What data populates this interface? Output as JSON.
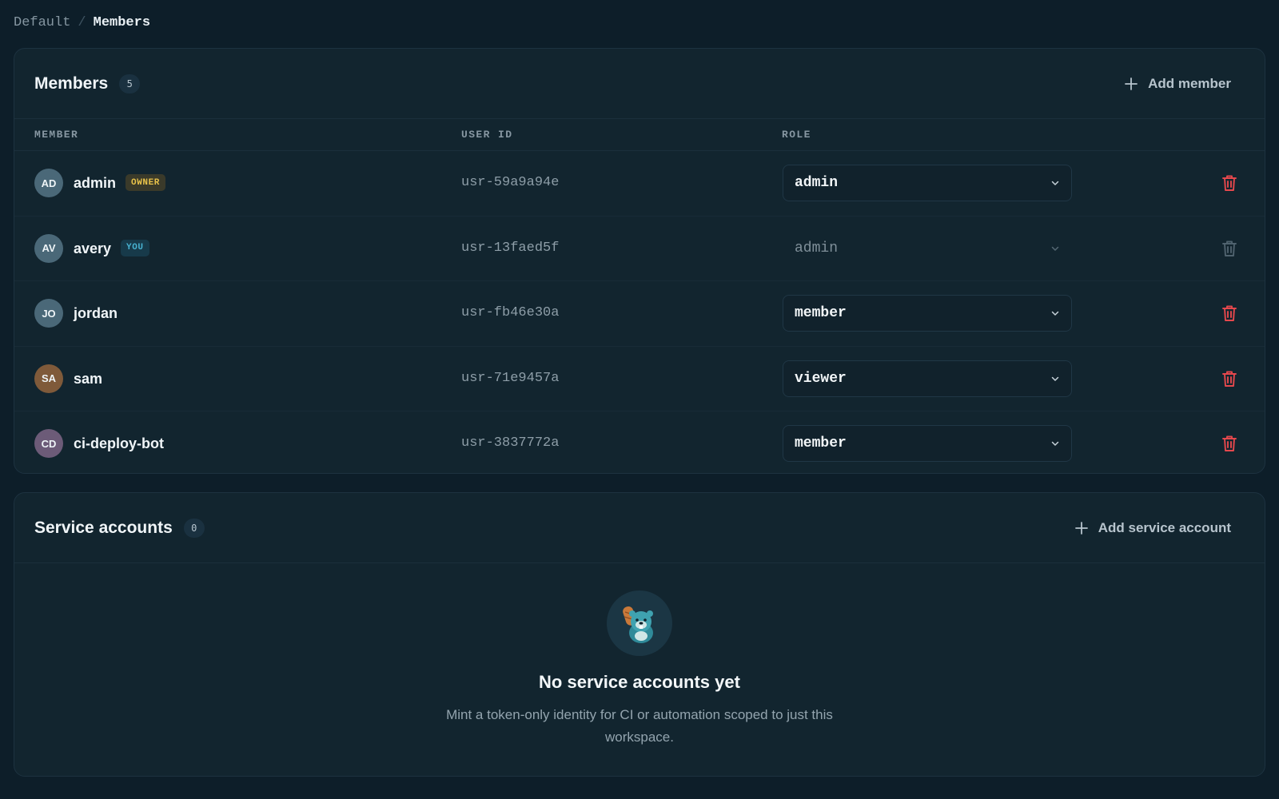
{
  "breadcrumb": {
    "root": "Default",
    "separator": "/",
    "current": "Members"
  },
  "members_panel": {
    "title": "Members",
    "count": "5",
    "add_label": "Add member",
    "columns": {
      "member": "MEMBER",
      "user_id": "USER ID",
      "role": "ROLE"
    },
    "rows": [
      {
        "initials": "AD",
        "name": "admin",
        "tag": "OWNER",
        "user_id": "usr-59a9a94e",
        "role": "admin",
        "editable": true,
        "avatar_color": "#4a6878"
      },
      {
        "initials": "AV",
        "name": "avery",
        "tag": "YOU",
        "user_id": "usr-13faed5f",
        "role": "admin",
        "editable": false,
        "avatar_color": "#4a6878"
      },
      {
        "initials": "JO",
        "name": "jordan",
        "tag": "",
        "user_id": "usr-fb46e30a",
        "role": "member",
        "editable": true,
        "avatar_color": "#4a6878"
      },
      {
        "initials": "SA",
        "name": "sam",
        "tag": "",
        "user_id": "usr-71e9457a",
        "role": "viewer",
        "editable": true,
        "avatar_color": "#7f5a3a"
      },
      {
        "initials": "CD",
        "name": "ci-deploy-bot",
        "tag": "",
        "user_id": "usr-3837772a",
        "role": "member",
        "editable": true,
        "avatar_color": "#6c5b78"
      }
    ]
  },
  "service_accounts_panel": {
    "title": "Service accounts",
    "count": "0",
    "add_label": "Add service account",
    "empty_title": "No service accounts yet",
    "empty_description": "Mint a token-only identity for CI or automation scoped to just this workspace."
  },
  "icons": {
    "add": "plus-icon",
    "dropdown": "chevron-down-icon",
    "delete": "trash-icon",
    "mascot": "beaver-mascot-icon"
  },
  "colors": {
    "danger": "#e5484d",
    "danger_disabled": "#4f626e",
    "owner_tag": "#e8c24a",
    "you_tag": "#48b3d2"
  }
}
